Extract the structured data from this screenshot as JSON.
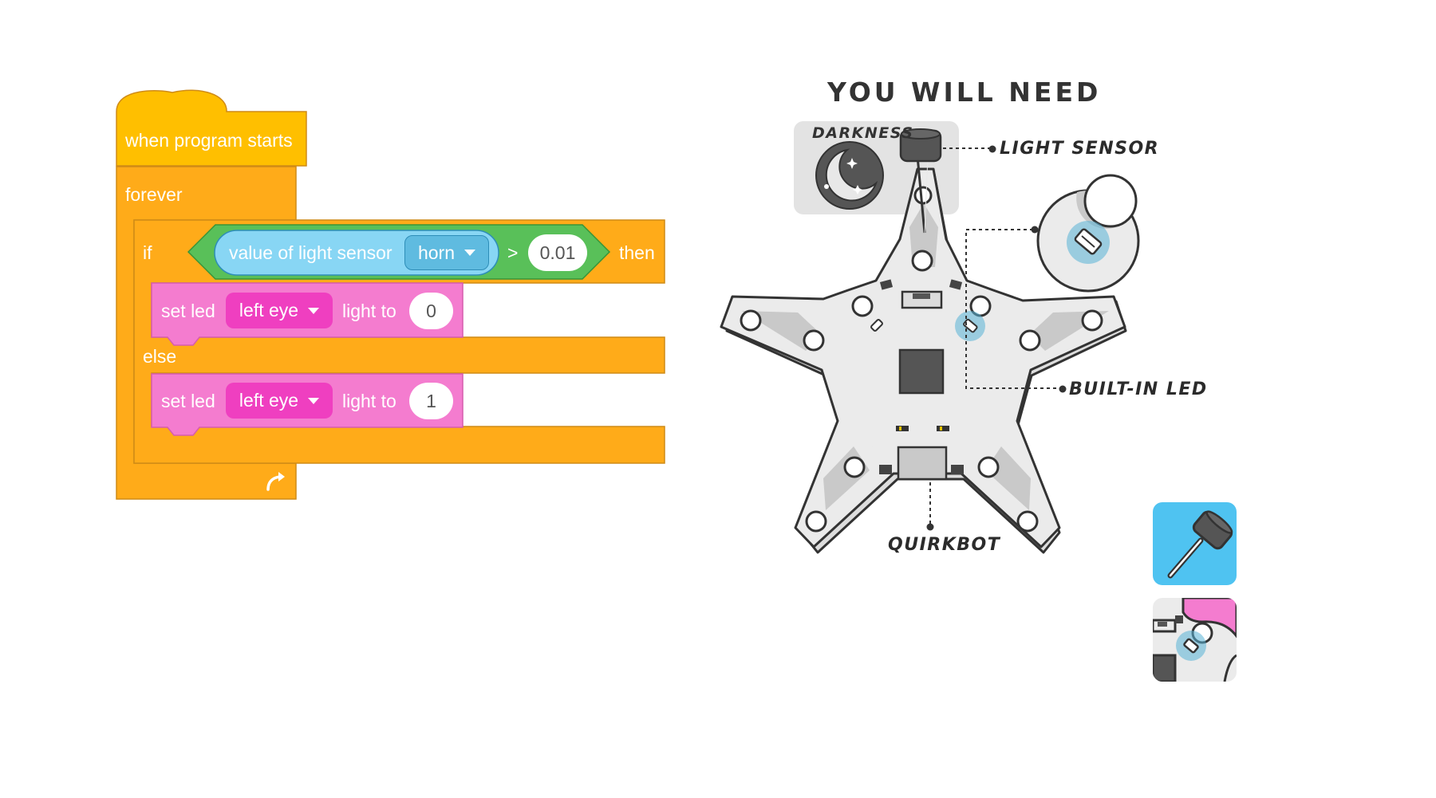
{
  "blocks": {
    "hat_label": "when program starts",
    "forever_label": "forever",
    "if_label": "if",
    "sensor_label": "value of light sensor",
    "sensor_port": "horn",
    "operator": ">",
    "threshold": "0.01",
    "then_label": "then",
    "set_led_label": "set led",
    "led_target": "left eye",
    "light_to_label": "light to",
    "value_if": "0",
    "else_label": "else",
    "value_else": "1"
  },
  "diagram": {
    "title": "YOU WILL NEED",
    "darkness_label": "DARKNESS",
    "light_sensor_label": "LIGHT SENSOR",
    "builtin_led_label": "BUILT-IN LED",
    "quirkbot_label": "QUIRKBOT"
  },
  "colors": {
    "event_yellow": "#ffbf00",
    "control_orange": "#ffab19",
    "control_border": "#cf8b17",
    "operator_green": "#59c059",
    "sensing_blue": "#5cc8ef",
    "led_pink": "#f47ccf",
    "dropdown_magenta": "#ef3fc0",
    "board_light_gray": "#ebebeb",
    "board_outline": "#333333",
    "highlight_blue": "#58b2d6",
    "thumbnail_blue": "#4fc3f1"
  }
}
